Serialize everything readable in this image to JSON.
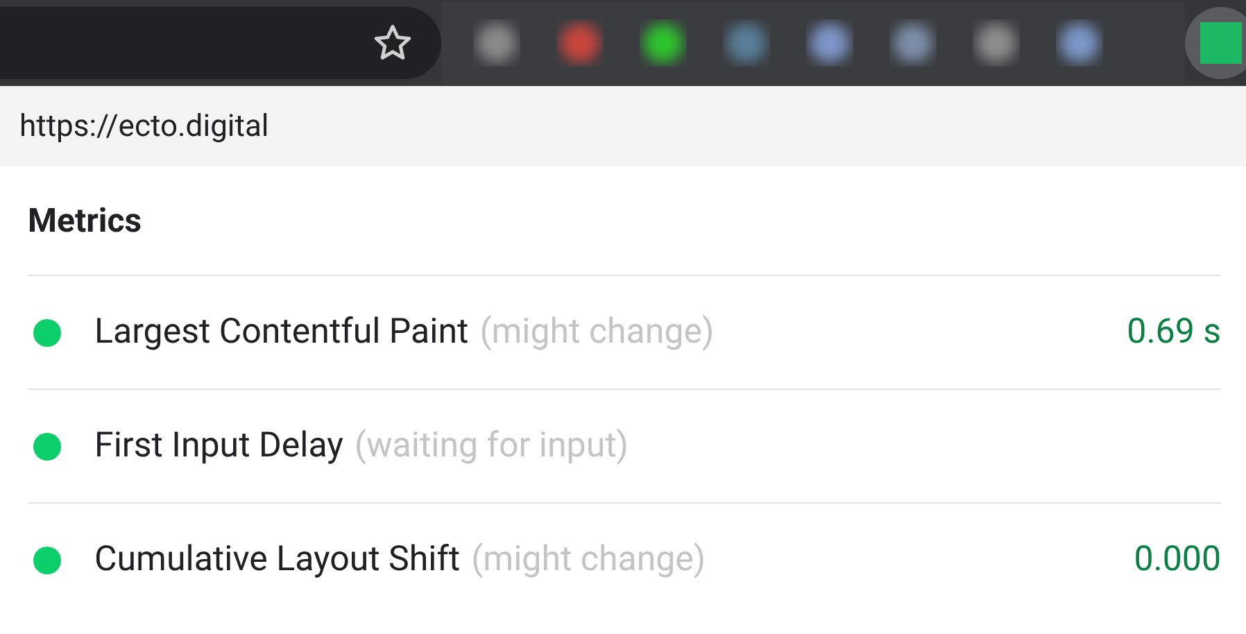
{
  "url": "https://ecto.digital",
  "title": "Metrics",
  "metrics": [
    {
      "name": "Largest Contentful Paint",
      "note": "(might change)",
      "value": "0.69 s",
      "color": "#0cce6b"
    },
    {
      "name": "First Input Delay",
      "note": "(waiting for input)",
      "color": "#0cce6b"
    },
    {
      "name": "Cumulative Layout Shift",
      "note": "(might change)",
      "value": "0.000",
      "color": "#0cce6b"
    }
  ]
}
